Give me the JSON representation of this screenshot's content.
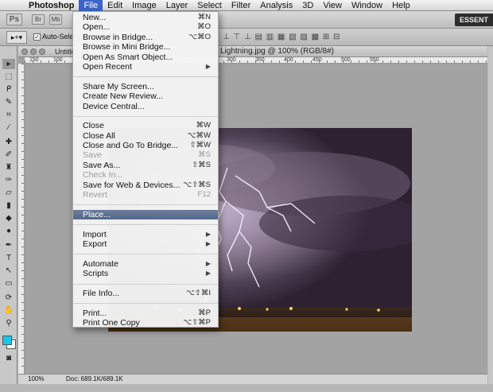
{
  "menubar": {
    "apple": "",
    "app": "Photoshop",
    "items": [
      "File",
      "Edit",
      "Image",
      "Layer",
      "Select",
      "Filter",
      "Analysis",
      "3D",
      "View",
      "Window",
      "Help"
    ]
  },
  "appbar": {
    "logo": "Ps",
    "bridge": "Br",
    "minibridge": "Mb",
    "workspace": "ESSENT"
  },
  "options": {
    "auto_select": "Auto-Select:"
  },
  "document": {
    "tab1": "Untitled-5 @ 1(",
    "tab2": "Lightning.jpg @ 100% (RGB/8#)",
    "zoom": "100%",
    "doc_size": "Doc: 689.1K/689.1K",
    "ruler_labels": [
      "150",
      "100",
      "50",
      "0",
      "50",
      "100",
      "150",
      "200",
      "250",
      "300",
      "350",
      "400",
      "450",
      "500",
      "550"
    ]
  },
  "file_menu": {
    "groups": [
      [
        {
          "label": "New...",
          "shortcut": "⌘N"
        },
        {
          "label": "Open...",
          "shortcut": "⌘O"
        },
        {
          "label": "Browse in Bridge...",
          "shortcut": "⌥⌘O"
        },
        {
          "label": "Browse in Mini Bridge...",
          "shortcut": ""
        },
        {
          "label": "Open As Smart Object...",
          "shortcut": ""
        },
        {
          "label": "Open Recent",
          "shortcut": "",
          "submenu": true
        }
      ],
      [
        {
          "label": "Share My Screen...",
          "shortcut": ""
        },
        {
          "label": "Create New Review...",
          "shortcut": ""
        },
        {
          "label": "Device Central...",
          "shortcut": ""
        }
      ],
      [
        {
          "label": "Close",
          "shortcut": "⌘W"
        },
        {
          "label": "Close All",
          "shortcut": "⌥⌘W"
        },
        {
          "label": "Close and Go To Bridge...",
          "shortcut": "⇧⌘W"
        },
        {
          "label": "Save",
          "shortcut": "⌘S",
          "disabled": true
        },
        {
          "label": "Save As...",
          "shortcut": "⇧⌘S"
        },
        {
          "label": "Check In...",
          "shortcut": "",
          "disabled": true
        },
        {
          "label": "Save for Web & Devices...",
          "shortcut": "⌥⇧⌘S"
        },
        {
          "label": "Revert",
          "shortcut": "F12",
          "disabled": true
        }
      ],
      [
        {
          "label": "Place...",
          "shortcut": "",
          "highlight": true
        }
      ],
      [
        {
          "label": "Import",
          "shortcut": "",
          "submenu": true
        },
        {
          "label": "Export",
          "shortcut": "",
          "submenu": true
        }
      ],
      [
        {
          "label": "Automate",
          "shortcut": "",
          "submenu": true
        },
        {
          "label": "Scripts",
          "shortcut": "",
          "submenu": true
        }
      ],
      [
        {
          "label": "File Info...",
          "shortcut": "⌥⇧⌘I"
        }
      ],
      [
        {
          "label": "Print...",
          "shortcut": "⌘P"
        },
        {
          "label": "Print One Copy",
          "shortcut": "⌥⇧⌘P"
        }
      ]
    ]
  },
  "colors": {
    "foreground": "#19c6ee",
    "background": "#ffffff",
    "menu_highlight": "#5b6f90"
  }
}
